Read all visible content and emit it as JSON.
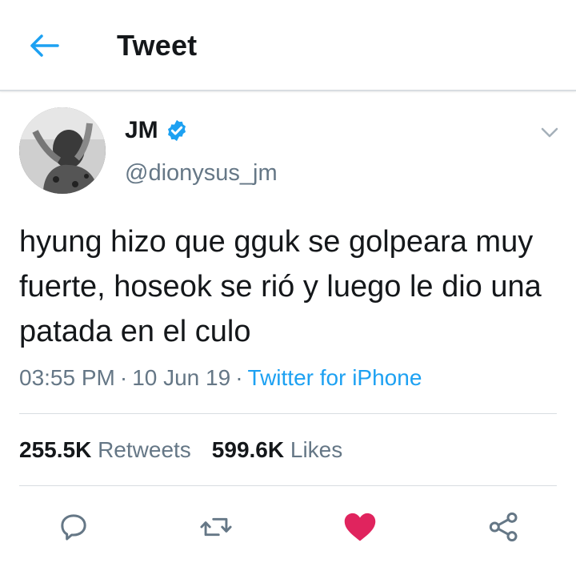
{
  "header": {
    "title": "Tweet",
    "back_icon": "arrow-left-icon"
  },
  "tweet": {
    "author_name": "JM",
    "handle": "@dionysus_jm",
    "verified": true,
    "text": "hyung hizo que gguk se golpeara muy fuerte, hoseok se rió y luego le dio una patada en el culo",
    "time": "03:55 PM",
    "date": "10 Jun 19",
    "source": "Twitter for iPhone",
    "separator": "·"
  },
  "stats": {
    "retweets_count": "255.5K",
    "retweets_label": "Retweets",
    "likes_count": "599.6K",
    "likes_label": "Likes"
  },
  "actions": {
    "reply_icon": "reply-icon",
    "retweet_icon": "retweet-icon",
    "like_icon": "heart-icon",
    "share_icon": "share-icon",
    "liked": true
  },
  "colors": {
    "accent": "#1da1f2",
    "secondary_text": "#657786",
    "like": "#e0245e",
    "divider": "#d8dde1"
  }
}
